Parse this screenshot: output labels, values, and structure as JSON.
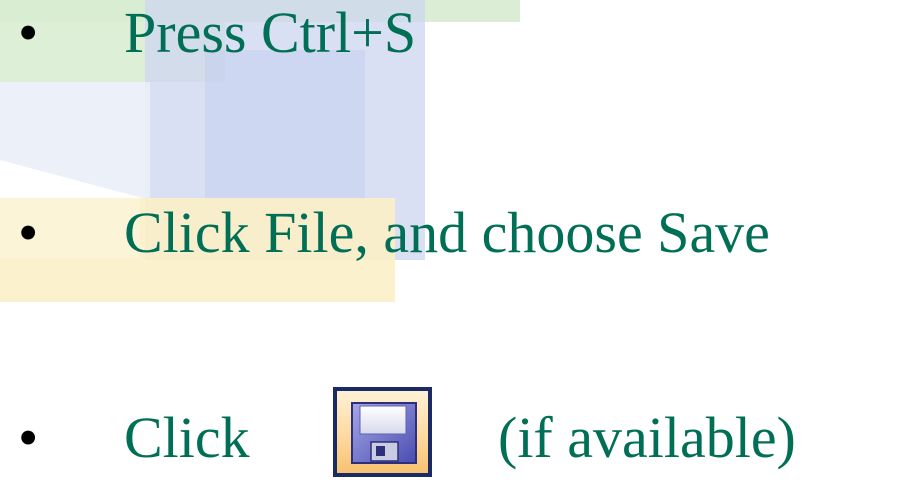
{
  "slide": {
    "bullets": [
      {
        "marker": "•",
        "text": "Press Ctrl+S"
      },
      {
        "marker": "•",
        "text": "Click File, and choose Save"
      },
      {
        "marker": "•",
        "text": "Click",
        "after_icon_text": "(if available)"
      }
    ],
    "save_icon": "floppy-disk-save-icon"
  },
  "colors": {
    "text_green": "#006f55",
    "bullet_black": "#000000",
    "icon_border": "#1a2a66",
    "icon_bg": "#ffd9a0"
  }
}
